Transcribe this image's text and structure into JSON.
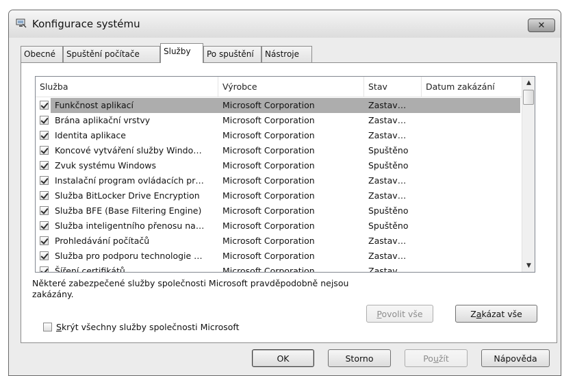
{
  "window": {
    "title": "Konfigurace systému",
    "close_glyph": "✕"
  },
  "tabs": [
    {
      "label": "Obecné",
      "active": false
    },
    {
      "label": "Spuštění počítače",
      "active": false
    },
    {
      "label": "Služby",
      "active": true
    },
    {
      "label": "Po spuštění",
      "active": false
    },
    {
      "label": "Nástroje",
      "active": false
    }
  ],
  "services_table": {
    "columns": [
      "Služba",
      "Výrobce",
      "Stav",
      "Datum zakázání"
    ],
    "rows": [
      {
        "checked": true,
        "name": "Funkčnost aplikací",
        "vendor": "Microsoft Corporation",
        "status": "Zastav…",
        "disabled_date": "",
        "selected": true
      },
      {
        "checked": true,
        "name": "Brána aplikační vrstvy",
        "vendor": "Microsoft Corporation",
        "status": "Zastav…",
        "disabled_date": ""
      },
      {
        "checked": true,
        "name": "Identita aplikace",
        "vendor": "Microsoft Corporation",
        "status": "Zastav…",
        "disabled_date": ""
      },
      {
        "checked": true,
        "name": "Koncové vytváření služby Windo…",
        "vendor": "Microsoft Corporation",
        "status": "Spuštěno",
        "disabled_date": ""
      },
      {
        "checked": true,
        "name": "Zvuk systému Windows",
        "vendor": "Microsoft Corporation",
        "status": "Spuštěno",
        "disabled_date": ""
      },
      {
        "checked": true,
        "name": "Instalační program ovládacích pr…",
        "vendor": "Microsoft Corporation",
        "status": "Zastav…",
        "disabled_date": ""
      },
      {
        "checked": true,
        "name": "Služba BitLocker Drive Encryption",
        "vendor": "Microsoft Corporation",
        "status": "Zastav…",
        "disabled_date": ""
      },
      {
        "checked": true,
        "name": "Služba BFE (Base Filtering Engine)",
        "vendor": "Microsoft Corporation",
        "status": "Spuštěno",
        "disabled_date": ""
      },
      {
        "checked": true,
        "name": "Služba inteligentního přenosu na…",
        "vendor": "Microsoft Corporation",
        "status": "Spuštěno",
        "disabled_date": ""
      },
      {
        "checked": true,
        "name": "Prohledávání počítačů",
        "vendor": "Microsoft Corporation",
        "status": "Zastav…",
        "disabled_date": ""
      },
      {
        "checked": true,
        "name": "Služba pro podporu technologie …",
        "vendor": "Microsoft Corporation",
        "status": "Zastav…",
        "disabled_date": ""
      },
      {
        "checked": true,
        "name": "Šíření certifikátů",
        "vendor": "Microsoft Corporation",
        "status": "Zastav…",
        "disabled_date": ""
      }
    ]
  },
  "notice": "Některé zabezpečené služby společnosti Microsoft pravděpodobně nejsou zakázány.",
  "enable_all": {
    "pre": "",
    "key": "P",
    "post": "ovolit vše"
  },
  "disable_all": {
    "pre": "Z",
    "key": "a",
    "post": "kázat vše"
  },
  "hide_ms": {
    "pre": "",
    "key": "S",
    "post": "krýt všechny služby společnosti Microsoft",
    "checked": false
  },
  "buttons": {
    "ok": "OK",
    "cancel": "Storno",
    "apply": {
      "pre": "Po",
      "key": "u",
      "post": "žít"
    },
    "help": "Nápověda"
  },
  "colors": {
    "selection": "#adadad",
    "disabled_text": "#8d8d8d"
  }
}
